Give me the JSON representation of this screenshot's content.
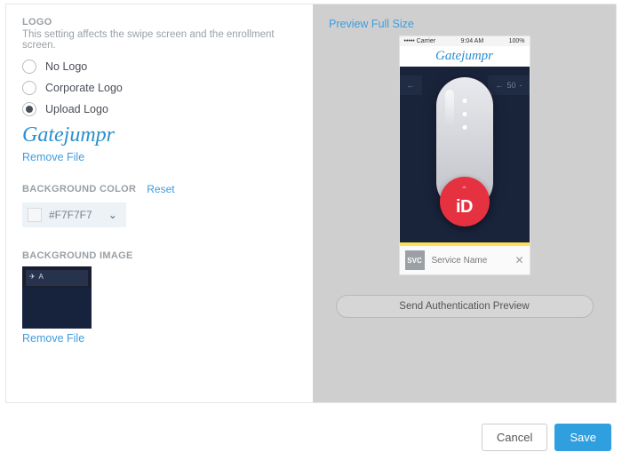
{
  "logo": {
    "section_label": "LOGO",
    "description": "This setting affects the swipe screen and the enrollment screen.",
    "options": {
      "no_logo": "No Logo",
      "corporate_logo": "Corporate Logo",
      "upload_logo": "Upload Logo"
    },
    "selected": "upload_logo",
    "preview_text": "Gatejumpr",
    "remove_link": "Remove File"
  },
  "background_color": {
    "label": "BACKGROUND COLOR",
    "reset_link": "Reset",
    "value": "#F7F7F7"
  },
  "background_image": {
    "label": "BACKGROUND IMAGE",
    "remove_link": "Remove File"
  },
  "preview": {
    "link": "Preview Full Size",
    "statusbar": {
      "carrier": "••••• Carrier",
      "time": "9:04 AM",
      "battery": "100%"
    },
    "logo_text": "Gatejumpr",
    "badge_text": "iD",
    "svc_box": "SVC",
    "svc_name": "Service Name",
    "send_button": "Send Authentication Preview",
    "sign_right": "50"
  },
  "footer": {
    "cancel": "Cancel",
    "save": "Save"
  }
}
